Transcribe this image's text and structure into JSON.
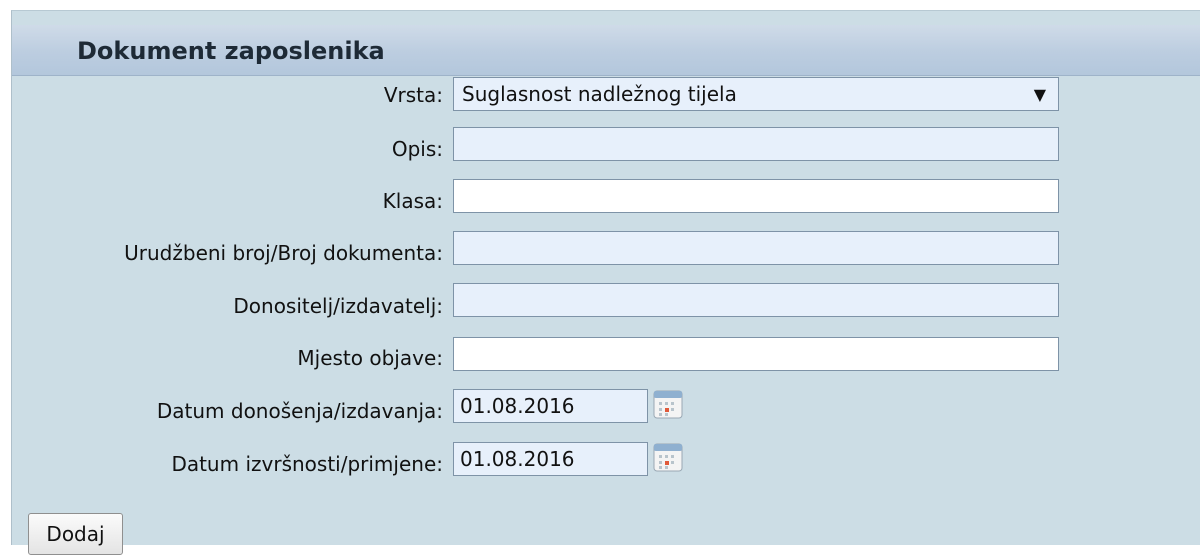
{
  "panel": {
    "title": "Dokument zaposlenika"
  },
  "form": {
    "vrsta": {
      "label": "Vrsta:",
      "value": "Suglasnost nadležnog tijela",
      "arrow": "▼"
    },
    "opis": {
      "label": "Opis:",
      "value": ""
    },
    "klasa": {
      "label": "Klasa:",
      "value": ""
    },
    "urudzbeni": {
      "label": "Urudžbeni broj/Broj dokumenta:",
      "value": ""
    },
    "donositelj": {
      "label": "Donositelj/izdavatelj:",
      "value": ""
    },
    "mjesto": {
      "label": "Mjesto objave:",
      "value": ""
    },
    "datum_donosenja": {
      "label": "Datum donošenja/izdavanja:",
      "value": "01.08.2016",
      "icon": "calendar-icon"
    },
    "datum_izvrsnosti": {
      "label": "Datum izvršnosti/primjene:",
      "value": "01.08.2016",
      "icon": "calendar-icon"
    }
  },
  "actions": {
    "add_label": "Dodaj"
  },
  "colors": {
    "panel_bg": "#ccdde5",
    "input_bg": "#e7f0fb",
    "header_bg": "#bccde0"
  }
}
